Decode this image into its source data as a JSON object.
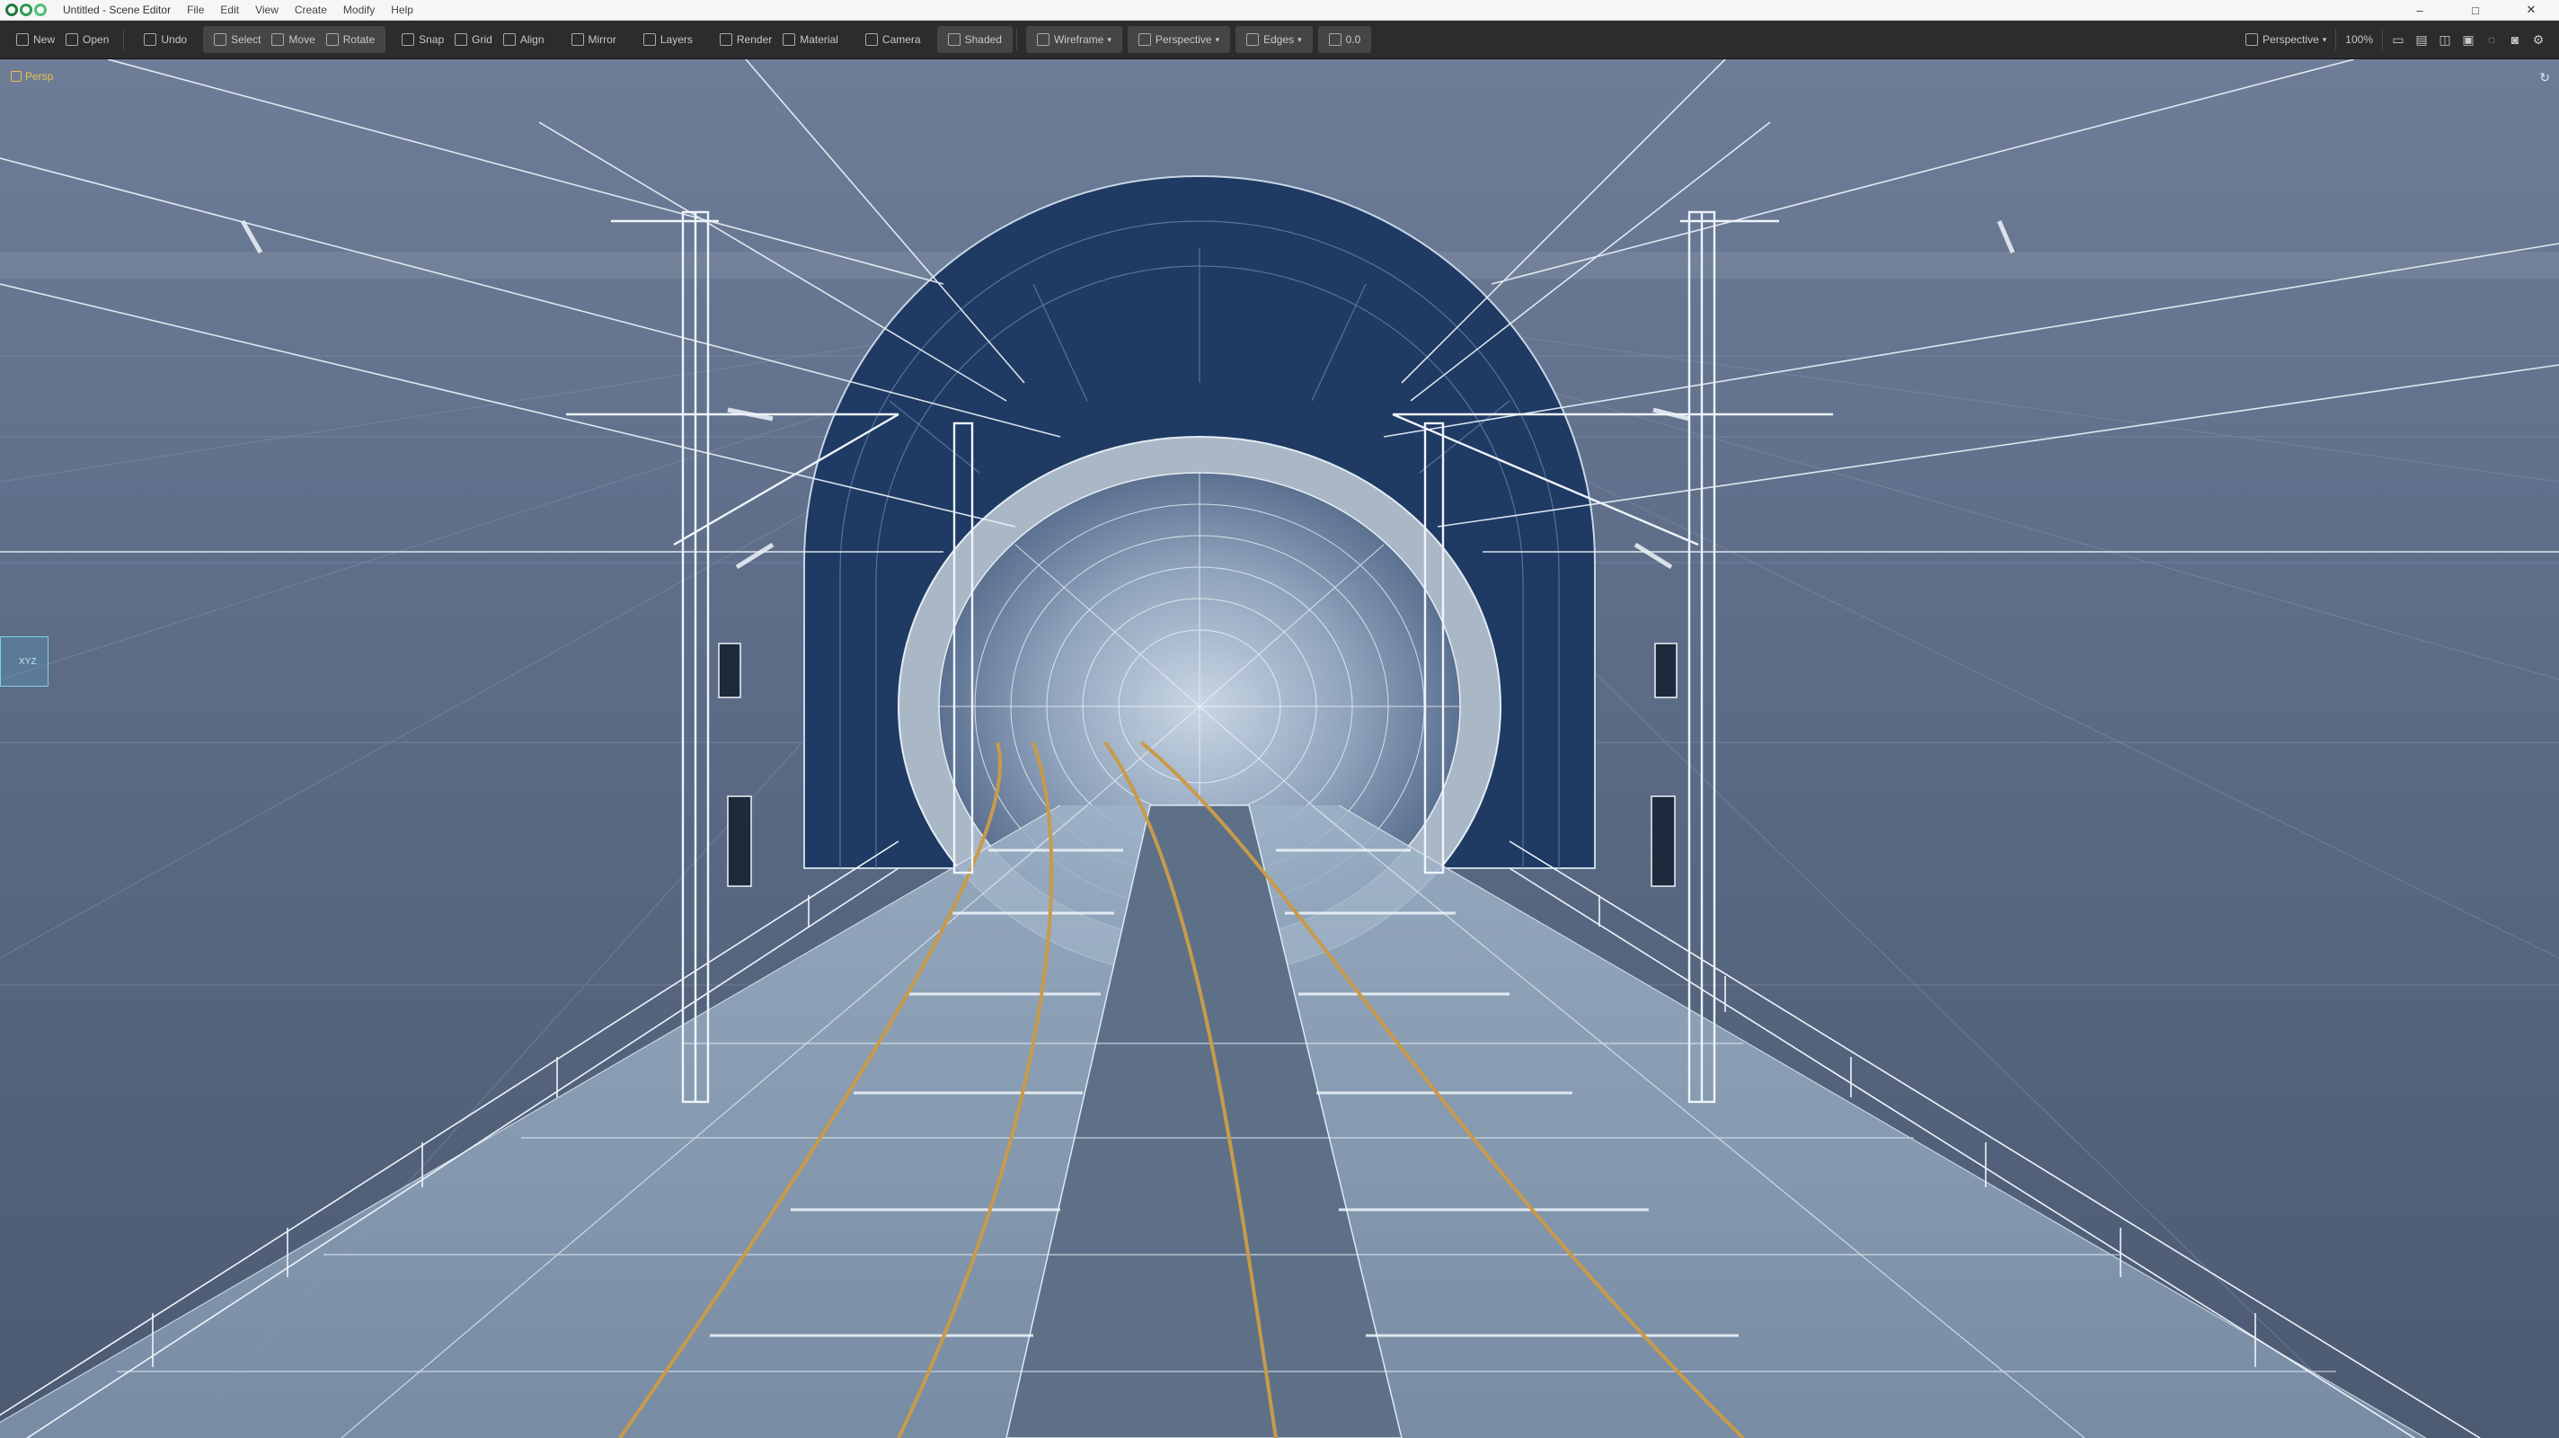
{
  "window": {
    "title": "Untitled - Scene Editor",
    "menus": [
      "File",
      "Edit",
      "View",
      "Create",
      "Modify",
      "Help"
    ],
    "controls": {
      "minimize": "–",
      "maximize": "□",
      "close": "✕"
    }
  },
  "toolbar": {
    "groups": [
      {
        "id": "file",
        "items": [
          "New",
          "Open"
        ]
      },
      {
        "id": "edit",
        "items": [
          "Undo"
        ]
      },
      {
        "id": "select",
        "items": [
          "Select",
          "Move",
          "Rotate"
        ],
        "active": true
      },
      {
        "id": "snap",
        "items": [
          "Snap",
          "Grid",
          "Align"
        ]
      },
      {
        "id": "mirror",
        "items": [
          "Mirror"
        ]
      },
      {
        "id": "layers",
        "items": [
          "Layers"
        ]
      },
      {
        "id": "render",
        "items": [
          "Render",
          "Material"
        ]
      },
      {
        "id": "camera",
        "items": [
          "Camera"
        ]
      },
      {
        "id": "view",
        "items": [
          "Shaded"
        ]
      }
    ],
    "view_modes": [
      {
        "label": "Wireframe",
        "active": true
      },
      {
        "label": "Perspective",
        "active": true
      },
      {
        "label": "Edges",
        "active": true
      },
      {
        "label": "0.0",
        "active": true
      }
    ],
    "right": {
      "camera_preset": "Perspective",
      "zoom": "100%",
      "icons": [
        "layout-icon",
        "panel-icon",
        "split-icon",
        "material-icon",
        "light-icon",
        "render-icon",
        "settings-icon"
      ]
    }
  },
  "viewport": {
    "label": "Persp",
    "corner_icon": "↻",
    "gizmo_text": "XYZ",
    "colors": {
      "background": "#5b6b85",
      "wire": "#e3edf5",
      "rail": "#c89a4a",
      "tunnel_dark": "#1f3a63",
      "accent": "#7fd0e0"
    }
  }
}
